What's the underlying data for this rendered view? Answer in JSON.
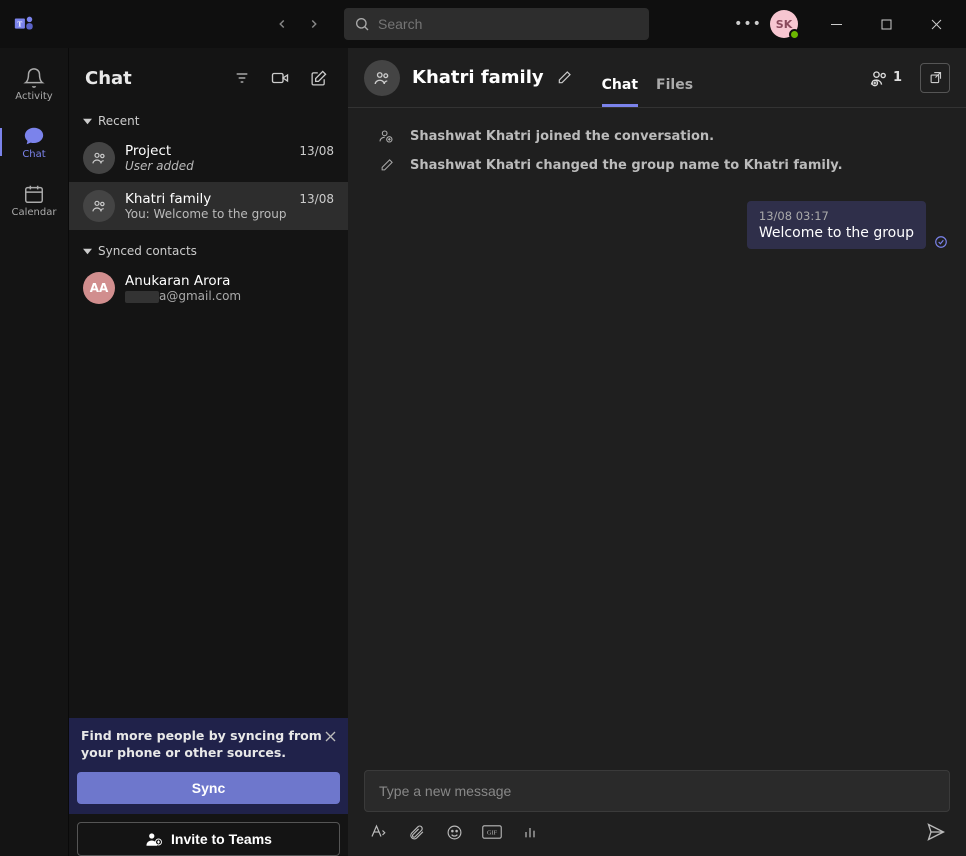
{
  "titlebar": {
    "search_placeholder": "Search",
    "avatar_initials": "SK"
  },
  "rail": {
    "activity": "Activity",
    "chat": "Chat",
    "calendar": "Calendar"
  },
  "chat_panel": {
    "title": "Chat",
    "section_recent": "Recent",
    "section_synced": "Synced contacts",
    "recent": [
      {
        "title": "Project",
        "preview": "User added",
        "time": "13/08"
      },
      {
        "title": "Khatri family",
        "preview": "You: Welcome to the group",
        "time": "13/08"
      }
    ],
    "synced": [
      {
        "name": "Anukaran Arora",
        "initials": "AA",
        "email_suffix": "a@gmail.com"
      }
    ],
    "footer_text": "Find more people by syncing from your phone or other sources.",
    "sync_btn": "Sync",
    "invite_btn": "Invite to Teams"
  },
  "convo": {
    "title": "Khatri family",
    "tabs": {
      "chat": "Chat",
      "files": "Files"
    },
    "participants_count": "1",
    "system_msgs": [
      "Shashwat Khatri joined the conversation.",
      "Shashwat Khatri changed the group name to Khatri family."
    ],
    "message": {
      "time": "13/08 03:17",
      "text": "Welcome to the group"
    },
    "compose_placeholder": "Type a new message"
  }
}
